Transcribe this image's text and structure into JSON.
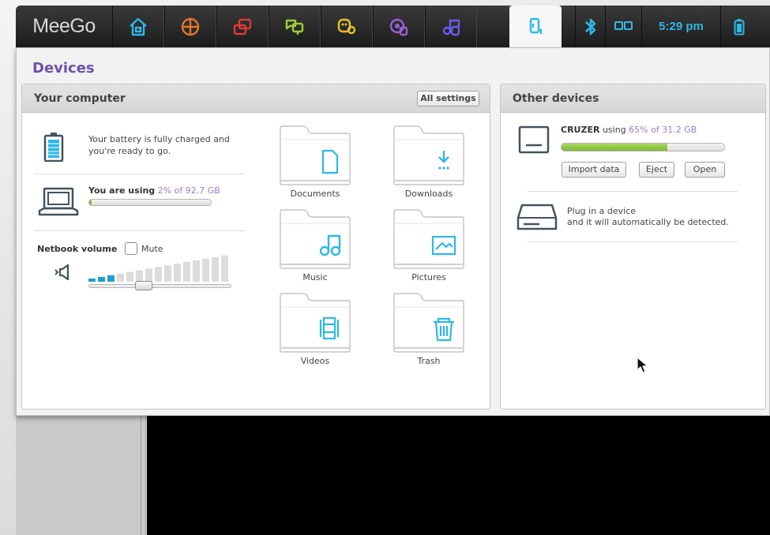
{
  "topbar": {
    "logo": "MeeGo",
    "zones": [
      {
        "name": "home-icon",
        "color": "#2eb8e6"
      },
      {
        "name": "applications-icon",
        "color": "#e0762a"
      },
      {
        "name": "zones-icon",
        "color": "#e03a3a"
      },
      {
        "name": "status-icon",
        "color": "#9ad034"
      },
      {
        "name": "people-icon",
        "color": "#e8c425"
      },
      {
        "name": "internet-icon",
        "color": "#9a5fd6"
      },
      {
        "name": "media-icon",
        "color": "#6a5cf0"
      },
      {
        "name": "devices-icon",
        "color": "#2eb8e6"
      }
    ],
    "clock": "5:29 pm"
  },
  "window": {
    "title": "Devices",
    "your_computer": {
      "header": "Your computer",
      "all_settings_label": "All settings",
      "battery_text_line1": "Your battery is fully charged and",
      "battery_text_line2": "you're ready to go.",
      "storage_prefix": "You are using",
      "storage_value": "2% of 92.7 GB",
      "storage_fraction": 0.02,
      "volume_label": "Netbook volume",
      "mute_label": "Mute",
      "volume_level": 0.22,
      "folders": [
        {
          "label": "Documents",
          "icon": "document-icon"
        },
        {
          "label": "Downloads",
          "icon": "download-icon"
        },
        {
          "label": "Music",
          "icon": "music-icon"
        },
        {
          "label": "Pictures",
          "icon": "picture-icon"
        },
        {
          "label": "Videos",
          "icon": "video-icon"
        },
        {
          "label": "Trash",
          "icon": "trash-icon"
        }
      ]
    },
    "other_devices": {
      "header": "Other devices",
      "device_name": "CRUZER",
      "device_using": "using",
      "device_usage": "65% of 31.2 GB",
      "device_fraction": 0.65,
      "import_label": "Import data",
      "eject_label": "Eject",
      "open_label": "Open",
      "plug_line1": "Plug in a device",
      "plug_line2": "and it will automatically be detected."
    }
  }
}
